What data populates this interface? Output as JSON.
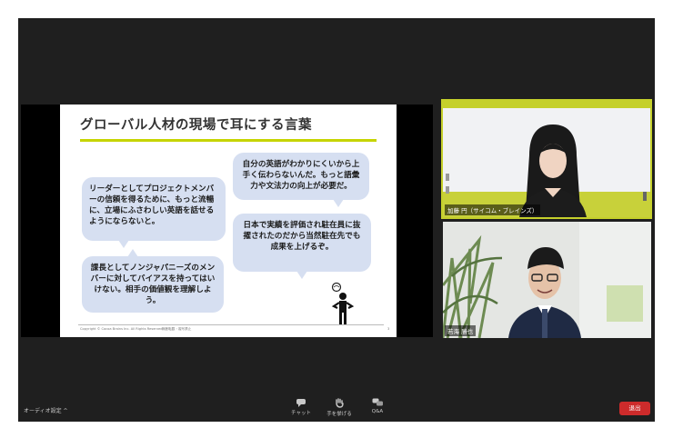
{
  "slide": {
    "title": "グローバル人材の現場で耳にする言葉",
    "bubble1": "リーダーとしてプロジェクトメンバーの信頼を得るために、もっと流暢に、立場にふさわしい英語を話せるようにならないと。",
    "bubble2": "課長としてノンジャパニーズのメンバーに対してバイアスを持ってはいけない。相手の価値観を理解しよう。",
    "bubble3": "自分の英語がわかりにくいから上手く伝わらないんだ。もっと語彙力や文法力の向上が必要だ。",
    "bubble4": "日本で実績を評価され駐在員に抜擢されたのだから当然駐在先でも成果を上げるぞ。",
    "footer_left": "Copyright © Cocoa Brains Inc. All Rights Reserved",
    "footer_mid": "無断転載・複写禁止",
    "page_number": "3"
  },
  "participants": [
    {
      "name": "加藤 円（サイコム・ブレインズ）"
    },
    {
      "name": "若海 勝也"
    }
  ],
  "toolbar": {
    "audio_label": "オーディオ設定",
    "chat_label": "チャット",
    "raise_hand_label": "手を挙げる",
    "qa_label": "Q&A",
    "leave_label": "退出"
  },
  "colors": {
    "accent": "#c6d400",
    "bubble": "#d6dff1",
    "leave": "#cd2b2b"
  }
}
